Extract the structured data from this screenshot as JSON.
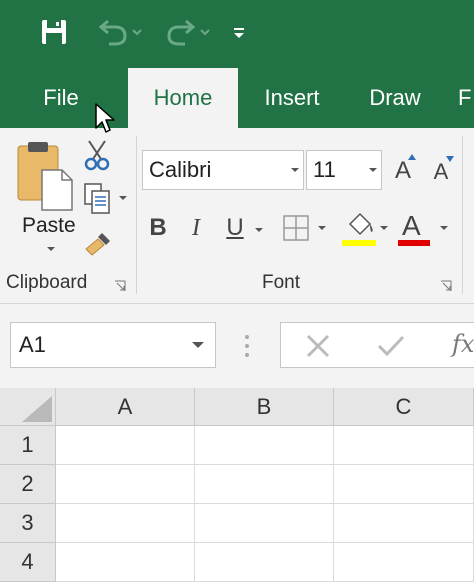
{
  "qat": {
    "icons": [
      "save-icon",
      "undo-icon",
      "redo-icon",
      "customize-qat-icon"
    ]
  },
  "tabs": [
    {
      "label": "File",
      "active": false
    },
    {
      "label": "Home",
      "active": true
    },
    {
      "label": "Insert",
      "active": false
    },
    {
      "label": "Draw",
      "active": false
    },
    {
      "label": "F",
      "active": false
    }
  ],
  "ribbon": {
    "clipboard": {
      "label": "Clipboard",
      "paste_label": "Paste"
    },
    "font": {
      "label": "Font",
      "font_name": "Calibri",
      "font_size": "11",
      "bold": "B",
      "italic": "I",
      "underline": "U",
      "font_color_glyph": "A",
      "grow_glyph": "A",
      "shrink_glyph": "A",
      "highlight_color": "#ffff00",
      "font_color": "#e00000"
    }
  },
  "formula_bar": {
    "name_box": "A1",
    "fx": "fx"
  },
  "grid": {
    "columns": [
      "A",
      "B",
      "C"
    ],
    "rows": [
      "1",
      "2",
      "3",
      "4"
    ]
  },
  "colors": {
    "brand": "#217346",
    "ribbon_bg": "#f3f3f3"
  }
}
